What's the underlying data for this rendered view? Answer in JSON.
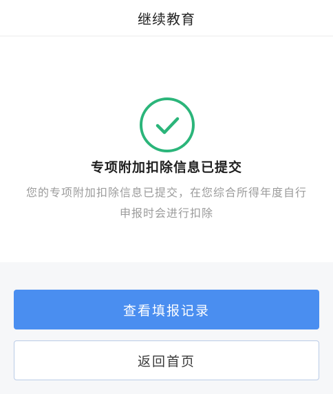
{
  "header": {
    "title": "继续教育"
  },
  "result": {
    "icon": "check-circle-icon",
    "icon_color": "#2bb57a",
    "title": "专项附加扣除信息已提交",
    "description": "您的专项附加扣除信息已提交，在您综合所得年度自行申报时会进行扣除"
  },
  "actions": {
    "primary_label": "查看填报记录",
    "primary_color": "#4a8ef0",
    "secondary_label": "返回首页"
  }
}
